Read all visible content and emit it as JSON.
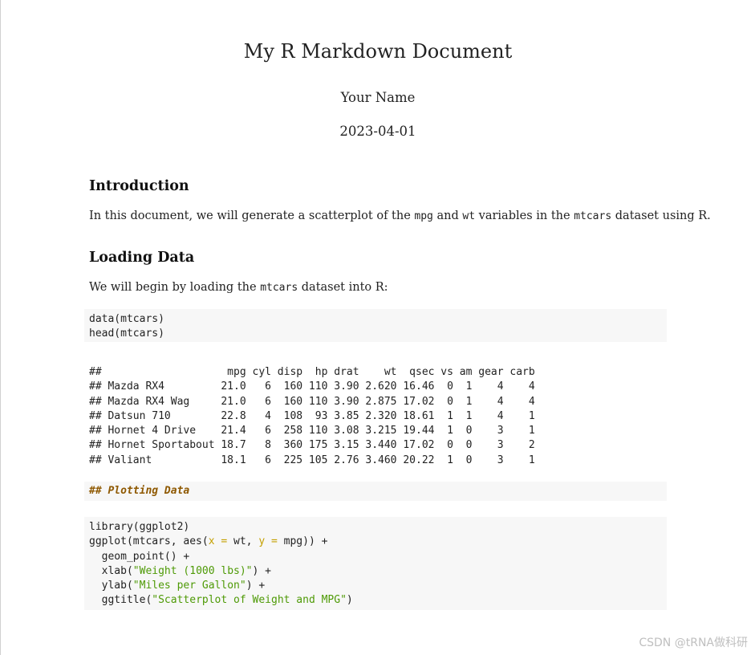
{
  "document": {
    "title": "My R Markdown Document",
    "author": "Your Name",
    "date": "2023-04-01"
  },
  "intro": {
    "heading": "Introduction",
    "text_before": "In this document, we will generate a scatterplot of the ",
    "var1": "mpg",
    "text_and": " and ",
    "var2": "wt",
    "text_mid": " variables in the ",
    "dataset": "mtcars",
    "text_after": " dataset using R."
  },
  "loading": {
    "heading": "Loading Data",
    "text_before": "We will begin by loading the ",
    "dataset": "mtcars",
    "text_after": " dataset into R:",
    "code_line1": "data(mtcars)",
    "code_line2": "head(mtcars)"
  },
  "output": {
    "header": "##                    mpg cyl disp  hp drat    wt  qsec vs am gear carb",
    "rows": [
      "## Mazda RX4         21.0   6  160 110 3.90 2.620 16.46  0  1    4    4",
      "## Mazda RX4 Wag     21.0   6  160 110 3.90 2.875 17.02  0  1    4    4",
      "## Datsun 710        22.8   4  108  93 3.85 2.320 18.61  1  1    4    1",
      "## Hornet 4 Drive    21.4   6  258 110 3.08 3.215 19.44  1  0    3    1",
      "## Hornet Sportabout 18.7   8  360 175 3.15 3.440 17.02  0  0    3    2",
      "## Valiant           18.1   6  225 105 2.76 3.460 20.22  1  0    3    1"
    ]
  },
  "plotting": {
    "comment": "## Plotting Data",
    "code": {
      "l1": "library(ggplot2)",
      "l2_a": "ggplot(mtcars, aes(",
      "l2_x": "x =",
      "l2_b": " wt, ",
      "l2_y": "y =",
      "l2_c": " mpg)) +",
      "l3": "  geom_point() +",
      "l4_a": "  xlab(",
      "l4_s": "\"Weight (1000 lbs)\"",
      "l4_b": ") +",
      "l5_a": "  ylab(",
      "l5_s": "\"Miles per Gallon\"",
      "l5_b": ") +",
      "l6_a": "  ggtitle(",
      "l6_s": "\"Scatterplot of Weight and MPG\"",
      "l6_b": ")"
    }
  },
  "watermark": "CSDN @tRNA做科研"
}
